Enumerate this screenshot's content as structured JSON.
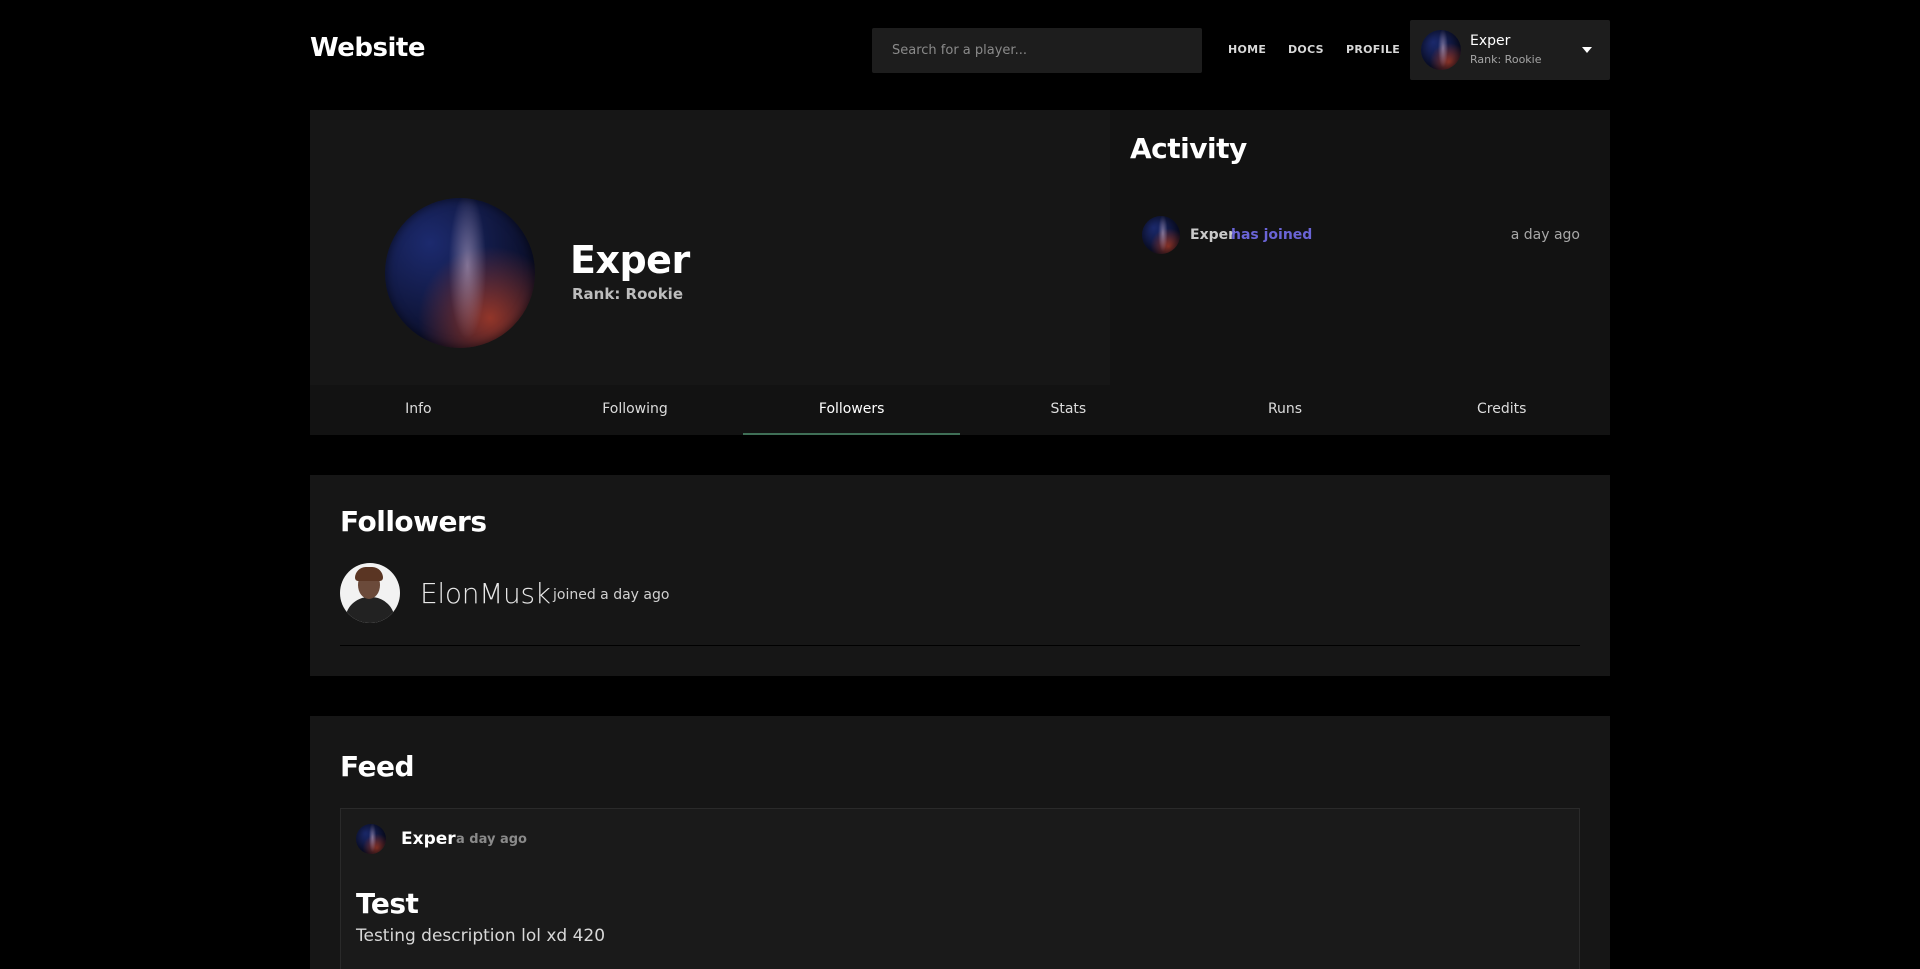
{
  "header": {
    "logo": "Website",
    "search_placeholder": "Search for a player...",
    "nav": [
      "HOME",
      "DOCS",
      "PROFILE"
    ],
    "user": {
      "name": "Exper",
      "rank": "Rank: Rookie"
    }
  },
  "profile": {
    "name": "Exper",
    "rank": "Rank: Rookie"
  },
  "activity": {
    "title": "Activity",
    "items": [
      {
        "user": "Exper",
        "verb": "has joined",
        "time": "a day ago"
      }
    ]
  },
  "tabs": [
    "Info",
    "Following",
    "Followers",
    "Stats",
    "Runs",
    "Credits"
  ],
  "active_tab": "Followers",
  "followers": {
    "title": "Followers",
    "items": [
      {
        "name": "ElonMusk",
        "joined": "joined a day ago"
      }
    ]
  },
  "feed": {
    "title": "Feed",
    "posts": [
      {
        "user": "Exper",
        "time": "a day ago",
        "title": "Test",
        "description": "Testing description lol xd 420"
      }
    ]
  },
  "colors": {
    "background": "#000000",
    "panel": "#161616",
    "accent_link": "#6a64d6",
    "tab_underline": "#3f6f56"
  }
}
